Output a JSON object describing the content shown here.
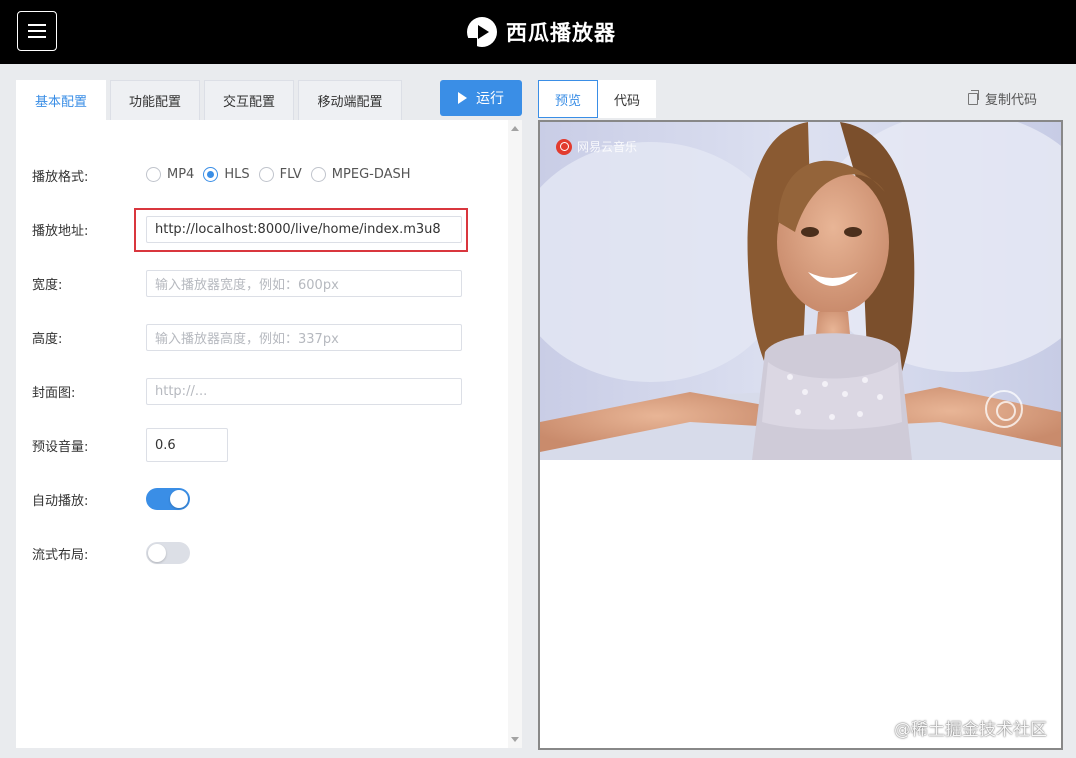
{
  "app": {
    "title": "西瓜播放器"
  },
  "left_tabs": [
    {
      "label": "基本配置",
      "active": true
    },
    {
      "label": "功能配置",
      "active": false
    },
    {
      "label": "交互配置",
      "active": false
    },
    {
      "label": "移动端配置",
      "active": false
    }
  ],
  "run_button": {
    "label": "运行"
  },
  "form": {
    "format": {
      "label": "播放格式:",
      "options": [
        {
          "label": "MP4",
          "checked": false
        },
        {
          "label": "HLS",
          "checked": true
        },
        {
          "label": "FLV",
          "checked": false
        },
        {
          "label": "MPEG-DASH",
          "checked": false
        }
      ]
    },
    "url": {
      "label": "播放地址:",
      "value": "http://localhost:8000/live/home/index.m3u8"
    },
    "width": {
      "label": "宽度:",
      "placeholder": "输入播放器宽度，例如：600px"
    },
    "height": {
      "label": "高度:",
      "placeholder": "输入播放器高度，例如：337px"
    },
    "poster": {
      "label": "封面图:",
      "placeholder": "http://..."
    },
    "volume": {
      "label": "预设音量:",
      "value": "0.6"
    },
    "autoplay": {
      "label": "自动播放:",
      "on": true
    },
    "fluid": {
      "label": "流式布局:",
      "on": false
    }
  },
  "right_tabs": [
    {
      "label": "预览",
      "active": true
    },
    {
      "label": "代码",
      "active": false
    }
  ],
  "copy_code": {
    "label": "复制代码"
  },
  "video": {
    "watermark": "网易云音乐"
  },
  "site_watermark": "@稀土掘金技术社区",
  "colors": {
    "accent": "#3a8ee6",
    "header": "#000000",
    "highlight": "#d9363e"
  }
}
